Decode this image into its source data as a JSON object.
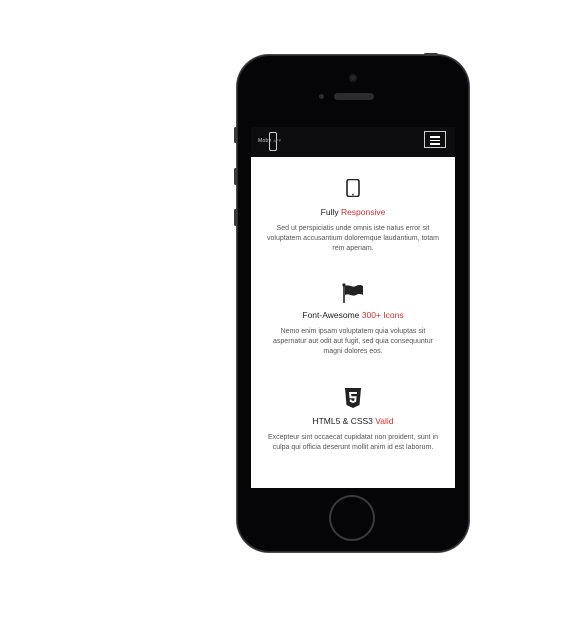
{
  "navbar": {
    "logo_text": "Moby",
    "logo_sub": "APP",
    "menu_icon": "hamburger-menu-icon"
  },
  "features": [
    {
      "icon": "tablet-icon",
      "title_plain": "Fully ",
      "title_accent": "Responsive",
      "text": "Sed ut perspiciatis unde omnis iste natus error sit voluptatem accusantium doloremque laudantium, totam rem aperiam."
    },
    {
      "icon": "flag-icon",
      "title_plain": "Font-Awesome ",
      "title_accent": "300+ Icons",
      "text": "Nemo enim ipsam voluptatem quia voluptas sit aspernatur aut odit aut fugit, sed quia consequuntur magni dolores eos."
    },
    {
      "icon": "html5-icon",
      "title_plain": "HTML5 & CSS3 ",
      "title_accent": "Valid",
      "text": "Excepteur sint occaecat cupidatat non proident, sunt in culpa qui officia deserunt mollit anim id est laborum."
    }
  ],
  "colors": {
    "accent": "#d32f2f",
    "phone_body": "#050507",
    "navbar_bg": "#0d0d0f"
  }
}
